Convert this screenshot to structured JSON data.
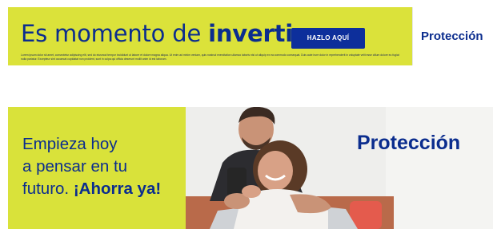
{
  "top_banner": {
    "headline_light": "Es momento de ",
    "headline_bold": "invertir",
    "cta_label": "HAZLO AQUÍ",
    "legal_text": "Lorem ipsum dolor sit amet, consectetur adipiscing elit, sed do eiusmod tempor incididunt ut labore et dolore magna aliqua. Ut enim ad minim veniam, quis nostrud exercitation ullamco laboris nisi ut aliquip ex ea commodo consequat. Duis aute irure dolor in reprehenderit in voluptate velit esse cillum dolore eu fugiat nulla pariatur. Excepteur sint occaecat cupidatat non proident, sunt in culpa qui officia deserunt mollit anim id est laborum.",
    "brand": "Protección"
  },
  "bottom_banner": {
    "line1": "Empieza hoy",
    "line2": "a pensar en tu",
    "line3_light": "futuro. ",
    "line3_bold": "¡Ahorra ya!",
    "brand": "Protección"
  },
  "colors": {
    "brand_blue": "#0b2d8e",
    "accent_yellow": "#dbe23a",
    "button_blue": "#0d2f9b"
  }
}
